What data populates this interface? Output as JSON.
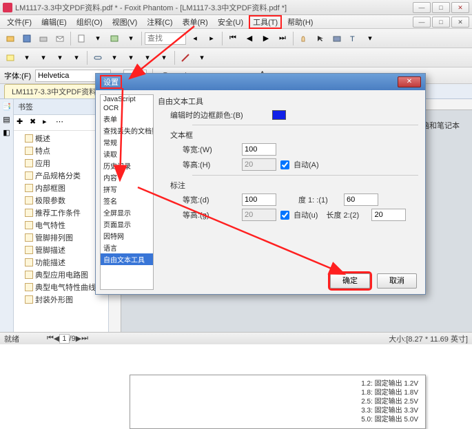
{
  "window": {
    "title": "LM1117-3.3中文PDF资料.pdf * - Foxit Phantom - [LM1117-3.3中文PDF资料.pdf *]"
  },
  "menu": {
    "file": "文件(F)",
    "edit": "编辑(E)",
    "organize": "组织(O)",
    "view": "视图(V)",
    "comment": "注释(C)",
    "form": "表单(R)",
    "security": "安全(U)",
    "tools": "工具(T)",
    "help": "帮助(H)"
  },
  "fontbar": {
    "label": "字体:(F)",
    "font": "Helvetica"
  },
  "doc_tab": "LM1117-3.3中文PDF资料",
  "bookmarks": {
    "title": "书签",
    "items": [
      "概述",
      "特点",
      "应用",
      "产品规格分类",
      "内部框图",
      "极限参数",
      "推荐工作条件",
      "电气特性",
      "管脚排列图",
      "管脚描述",
      "功能描述",
      "典型应用电路图",
      "典型电气特性曲线",
      "封装外形图"
    ]
  },
  "page_note": "电脑和笔记本",
  "page_lines": [
    "1.2: 固定输出 1.2V",
    "1.8: 固定输出 1.8V",
    "2.5: 固定输出 2.5V",
    "3.3: 固定输出 3.3V",
    "5.0: 固定输出 5.0V"
  ],
  "status": {
    "left": "就绪",
    "page_cur": "1",
    "page_sep": "/",
    "page_tot": "9",
    "size_label": "大小:",
    "size": "[8.27 * 11.69 英寸]"
  },
  "dialog": {
    "title": "设置",
    "categories": [
      "JavaScript",
      "OCR",
      "表单",
      "查找丢失的文档数",
      "常规",
      "读取",
      "历史记录",
      "内容",
      "拼写",
      "签名",
      "全屏显示",
      "页面显示",
      "因特网",
      "语言",
      "自由文本工具"
    ],
    "selected": "自由文本工具",
    "section1": {
      "title": "自由文本工具",
      "border_label": "编辑时的边框颜色:(B)"
    },
    "section2": {
      "title": "文本框",
      "width_label": "等宽:(W)",
      "width": "100",
      "height_label": "等高:(H)",
      "height": "20",
      "auto_label": "自动(A)"
    },
    "section3": {
      "title": "标注",
      "width_label": "等宽:(d)",
      "width": "100",
      "len1_label": "度 1: :(1)",
      "len1": "60",
      "height_label": "等高:(g)",
      "height": "20",
      "auto_label": "自动(u)",
      "len2_label": "长度 2:(2)",
      "len2": "20"
    },
    "ok": "确定",
    "cancel": "取消"
  },
  "search_placeholder": "查找"
}
